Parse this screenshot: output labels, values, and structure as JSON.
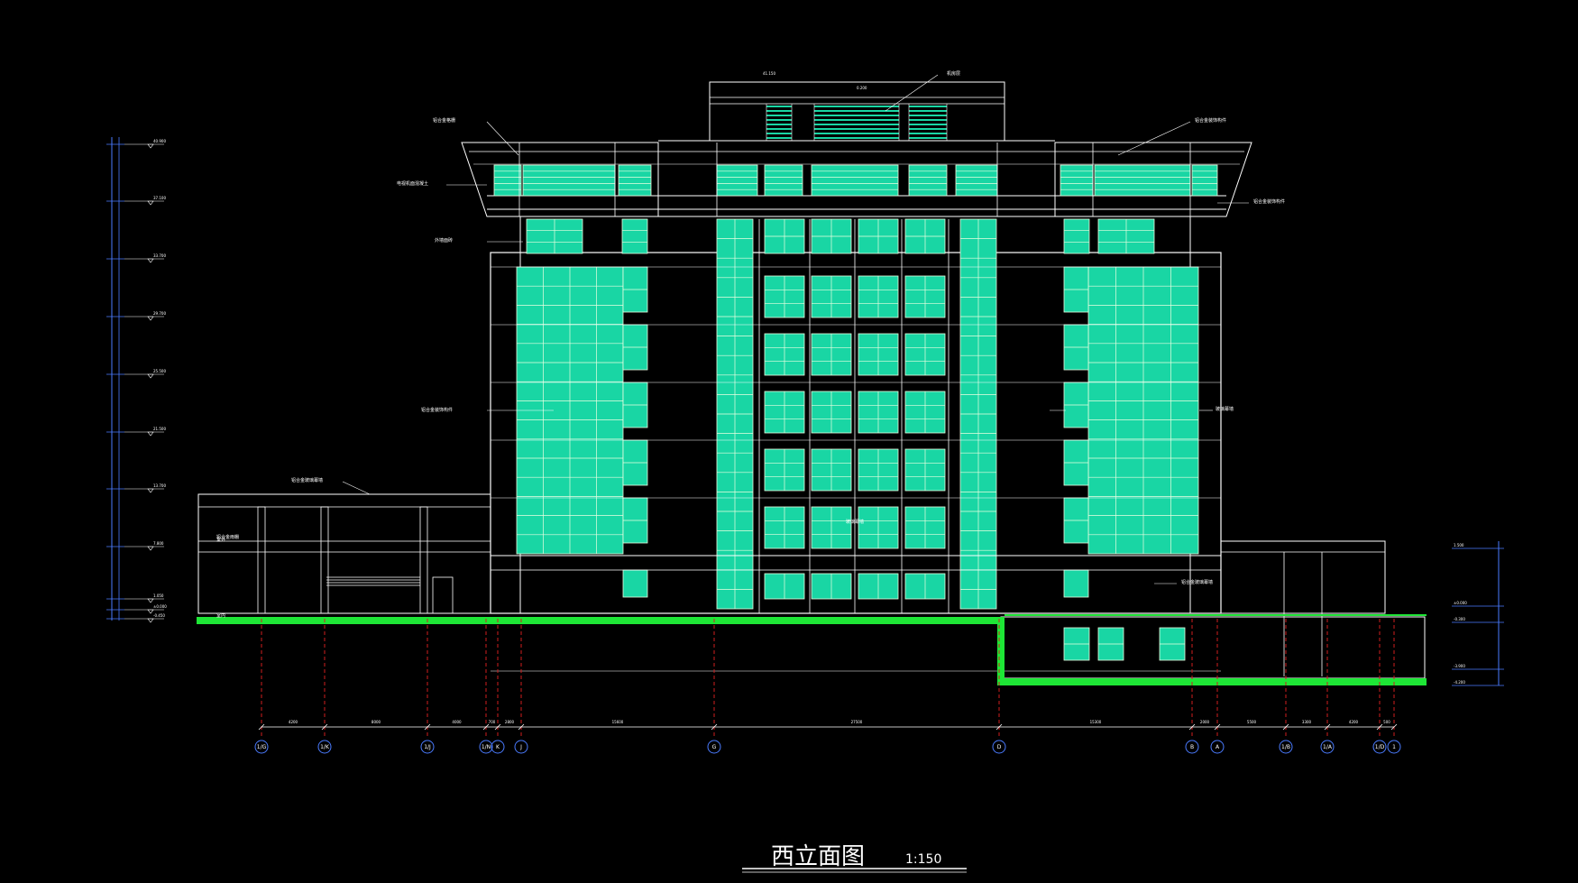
{
  "drawing": {
    "title": "西立面图",
    "scale": "1:150"
  },
  "colors": {
    "background": "#000000",
    "glass": "#19d6a4",
    "glass_line": "#e8ffe0",
    "ground": "#1ee636",
    "line": "#ffffff",
    "axis_line": "#d01e1e",
    "dimension": "#4a7bff",
    "frame": "#dedede"
  },
  "axes": {
    "labels": [
      "1/G",
      "1/K",
      "1/J",
      "1/N",
      "K",
      "J",
      "G",
      "D",
      "B",
      "A",
      "1/B",
      "1/A",
      "1/D",
      "1"
    ],
    "spacings": [
      "4200",
      "8000",
      "4000",
      "700",
      "2800",
      "15600",
      "27500",
      "15300",
      "2000",
      "5500",
      "3300",
      "4200",
      "500"
    ]
  },
  "elevations_left": [
    "40.900",
    "37.100",
    "33.700",
    "29.700",
    "25.500",
    "21.500",
    "13.700",
    "7.800",
    "1.050",
    "±0.000",
    "-0.450"
  ],
  "elevations_right": [
    "1.500",
    "±0.000",
    "-0.300",
    "-3.900",
    "-4.200"
  ],
  "annotations": {
    "left": [
      "铝合金格栅",
      "电视机面混凝土",
      "外墙面砖",
      "铝合金装饰构件",
      "铝合金玻璃幕墙",
      "铝合金雨棚"
    ],
    "right": [
      "铝合金装饰构件",
      "铝合金装饰构件",
      "玻璃幕墙",
      "铝合金玻璃幕墙"
    ],
    "top": [
      "机房层",
      "41.150",
      "0.200"
    ],
    "center": "玻璃幕墙",
    "floor_left": [
      "室外",
      "室内"
    ]
  }
}
